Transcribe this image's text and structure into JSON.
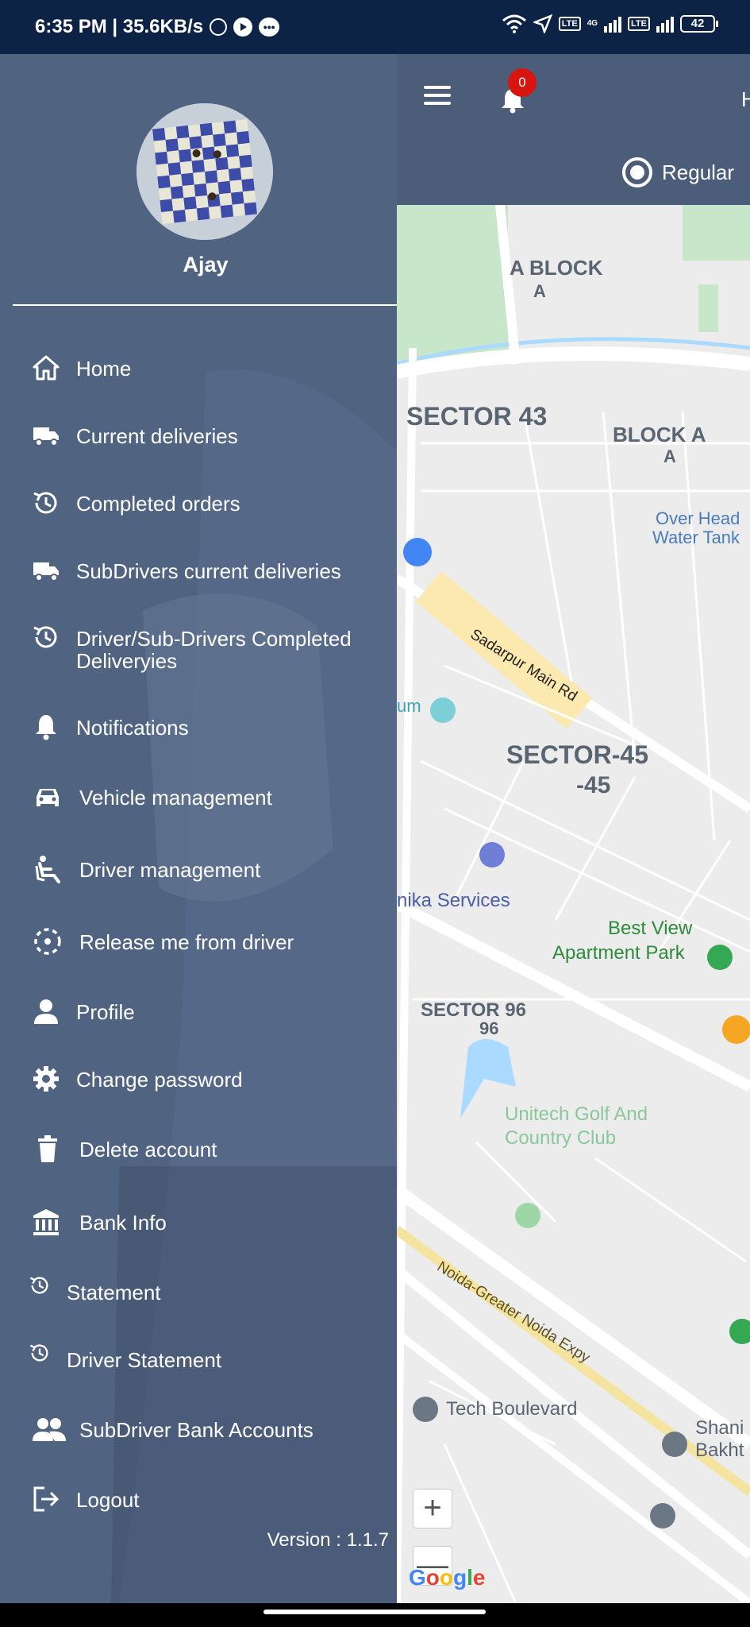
{
  "status_bar": {
    "time_speed": "6:35 PM | 35.6KB/s",
    "network_4g": "4G",
    "lte1": "Vo LTE",
    "lte2": "Vo LTE",
    "battery": "42"
  },
  "header": {
    "notification_count": "0",
    "header_letter": "H",
    "mode_label": "Regular"
  },
  "drawer": {
    "user_name": "Ajay",
    "version": "Version : 1.1.7",
    "menu": [
      {
        "label": "Home",
        "icon": "home-icon"
      },
      {
        "label": "Current deliveries",
        "icon": "truck-icon"
      },
      {
        "label": "Completed orders",
        "icon": "history-icon"
      },
      {
        "label": "SubDrivers current deliveries",
        "icon": "truck-icon"
      },
      {
        "label": "Driver/Sub-Drivers Completed Deliveryies",
        "icon": "history-icon"
      },
      {
        "label": "Notifications",
        "icon": "bell-icon"
      },
      {
        "label": "Vehicle management",
        "icon": "car-icon"
      },
      {
        "label": "Driver management",
        "icon": "seat-icon"
      },
      {
        "label": "Release me from driver",
        "icon": "dashed-circle-icon"
      },
      {
        "label": "Profile",
        "icon": "person-icon"
      },
      {
        "label": "Change password",
        "icon": "gear-icon"
      },
      {
        "label": "Delete account",
        "icon": "trash-icon"
      },
      {
        "label": "Bank Info",
        "icon": "bank-icon"
      },
      {
        "label": "Statement",
        "icon": "history-icon"
      },
      {
        "label": "Driver Statement",
        "icon": "history-icon"
      },
      {
        "label": "SubDriver Bank Accounts",
        "icon": "people-icon"
      },
      {
        "label": "Logout",
        "icon": "logout-icon"
      }
    ]
  },
  "map": {
    "labels": {
      "a_block": "A BLOCK",
      "a_block_sub": "A",
      "sector43": "SECTOR 43",
      "block_a": "BLOCK A",
      "block_a_sub": "A",
      "over_head_1": "Over Head",
      "over_head_2": "Water Tank",
      "sadarpur": "Sadarpur Main Rd",
      "um": "um",
      "sector45": "SECTOR-45",
      "sector45_sub": "-45",
      "nika": "nika Services",
      "best_view_1": "Best View",
      "best_view_2": "Apartment Park",
      "sector96": "SECTOR 96",
      "sector96_sub": "96",
      "golf_1": "Unitech Golf And",
      "golf_2": "Country Club",
      "expy": "Noida-Greater Noida Expy",
      "tech": "Tech Boulevard",
      "shani_1": "Shani",
      "shani_2": "Bakht",
      "google": "Google"
    },
    "zoom_in": "+",
    "zoom_out": "—"
  },
  "colors": {
    "drawer": "#506381",
    "header": "#4b5d79",
    "status_bar": "#0d2346",
    "badge": "#d8140f"
  }
}
